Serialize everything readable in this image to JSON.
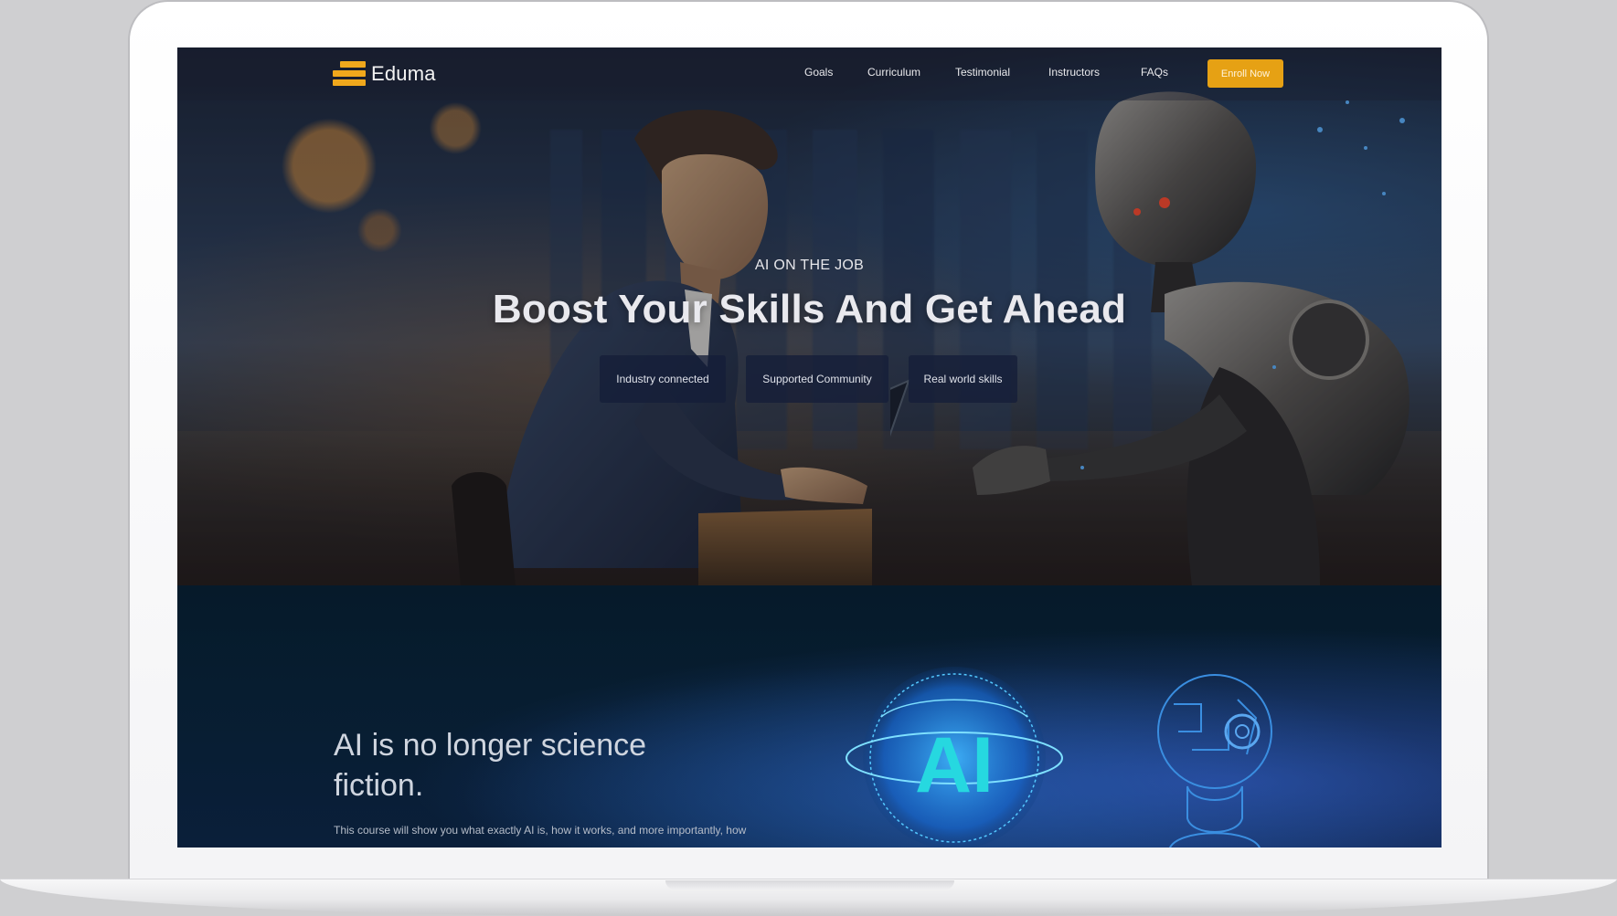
{
  "brand": {
    "name": "Eduma",
    "accent_color": "#e6a114"
  },
  "nav": {
    "links": [
      "Goals",
      "Curriculum",
      "Testimonial",
      "Instructors",
      "FAQs"
    ],
    "cta_label": "Enroll Now"
  },
  "hero": {
    "eyebrow": "AI ON THE JOB",
    "title": "Boost Your Skills And Get Ahead",
    "chips": [
      "Industry connected",
      "Supported Community",
      "Real world skills"
    ]
  },
  "intro": {
    "title": "AI is no longer science fiction.",
    "body": "This course will show you what exactly AI is, how it works, and more importantly, how",
    "graphic_label": "AI"
  }
}
